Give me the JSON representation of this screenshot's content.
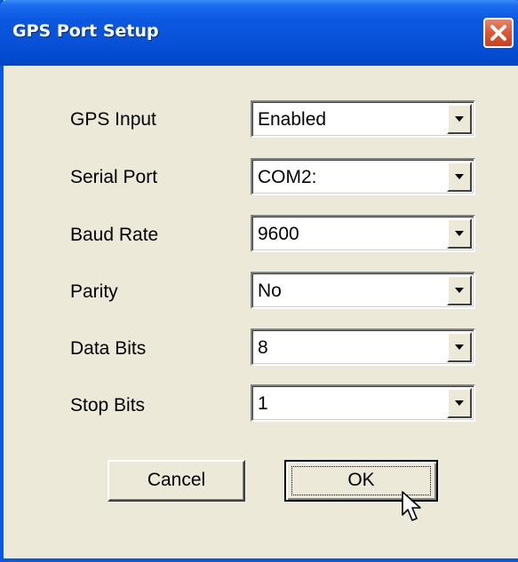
{
  "window": {
    "title": "GPS Port Setup",
    "title_color": "#ffffff",
    "titlebar_color": "#0b58e0",
    "client_background": "#ece9d8"
  },
  "fields": [
    {
      "label": "GPS Input",
      "value": "Enabled"
    },
    {
      "label": "Serial Port",
      "value": "COM2:"
    },
    {
      "label": "Baud Rate",
      "value": "9600"
    },
    {
      "label": "Parity",
      "value": "No"
    },
    {
      "label": "Data Bits",
      "value": "8"
    },
    {
      "label": "Stop Bits",
      "value": "1"
    }
  ],
  "buttons": {
    "cancel_label": "Cancel",
    "ok_label": "OK"
  },
  "icons": {
    "close": "close-icon",
    "dropdown": "chevron-down-icon",
    "cursor": "mouse-cursor-icon"
  }
}
